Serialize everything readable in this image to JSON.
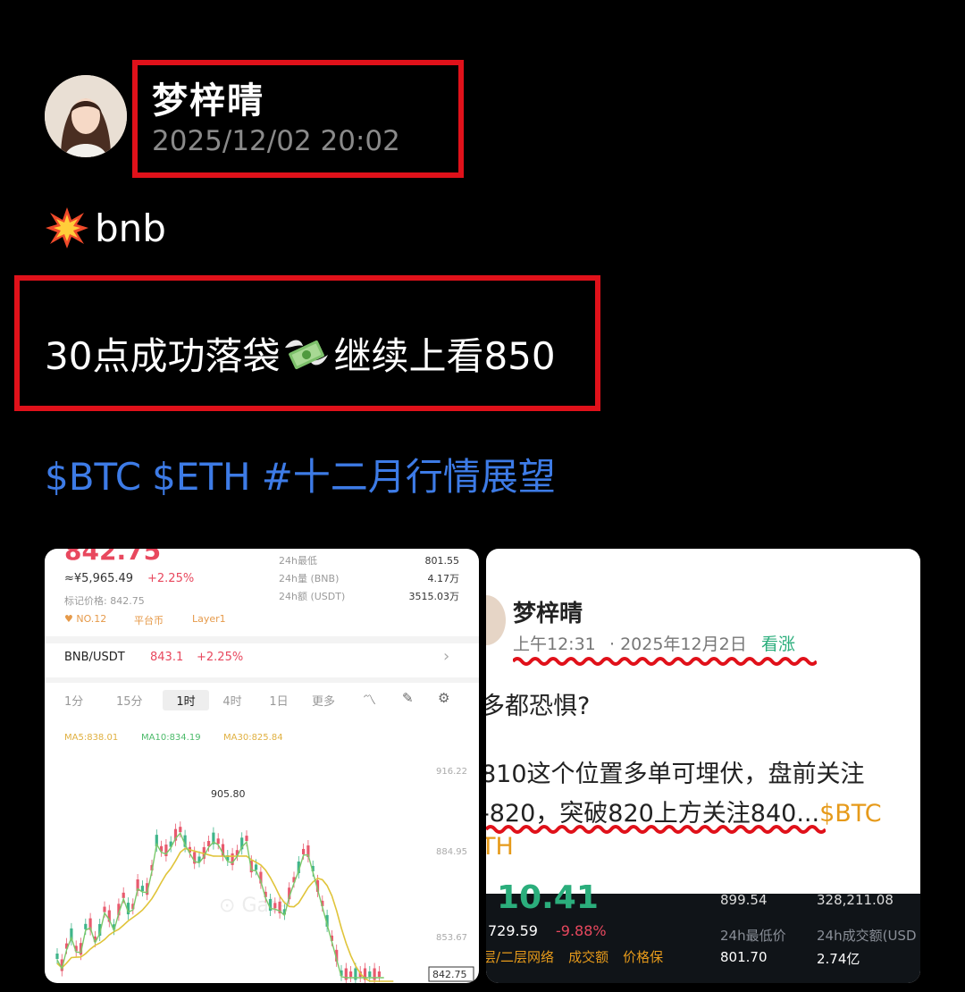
{
  "post": {
    "author": "梦梓晴",
    "timestamp": "2025/12/02 20:02",
    "line1_text": "bnb",
    "line2_prefix": "30点成功落袋",
    "line2_suffix": "继续上看850",
    "tags": [
      "$BTC",
      "$ETH",
      "#十二月行情展望"
    ]
  },
  "chart_shot": {
    "price_partial": "842.75",
    "cny": "≈¥5,965.49",
    "change": "+2.25%",
    "mark_price": "标记价格: 842.75",
    "rank": "NO.12",
    "tag1": "平台币",
    "tag2": "Layer1",
    "stats_labels": [
      "24h最低",
      "24h量 (BNB)",
      "24h额 (USDT)"
    ],
    "stats_values": [
      "801.55",
      "4.17万",
      "3515.03万"
    ],
    "pair": "BNB/USDT",
    "pair_price": "843.1",
    "pair_change": "+2.25%",
    "intervals": [
      "1分",
      "15分",
      "1时",
      "4时",
      "1日",
      "更多"
    ],
    "ma5": "MA5:838.01",
    "ma10": "MA10:834.19",
    "ma30": "MA30:825.84",
    "axis": [
      "916.22",
      "884.95",
      "853.67"
    ],
    "peak": "905.80",
    "last": "842.75",
    "watermark": "Gate"
  },
  "post_shot": {
    "author": "梦梓晴",
    "time": "上午12:31",
    "date": "· 2025年12月2日",
    "sentiment": "看涨",
    "q": "多都恐惧?",
    "body1": "810这个位置多单可埋伏，盘前关注",
    "body2": "-820，突破820上方关注840...",
    "body2_tag": "$BTC",
    "body3": "TH",
    "ticker_big": "10.41",
    "ticker_sub": "729.59",
    "ticker_change": "-9.88%",
    "labels_a": [
      "层/二层网络",
      "成交额",
      "价格保"
    ],
    "vals": [
      "899.54",
      "328,211.08"
    ],
    "low_label": "24h最低价",
    "vol_label": "24h成交额(USD",
    "low_val": "801.70",
    "vol_val": "2.74亿"
  }
}
